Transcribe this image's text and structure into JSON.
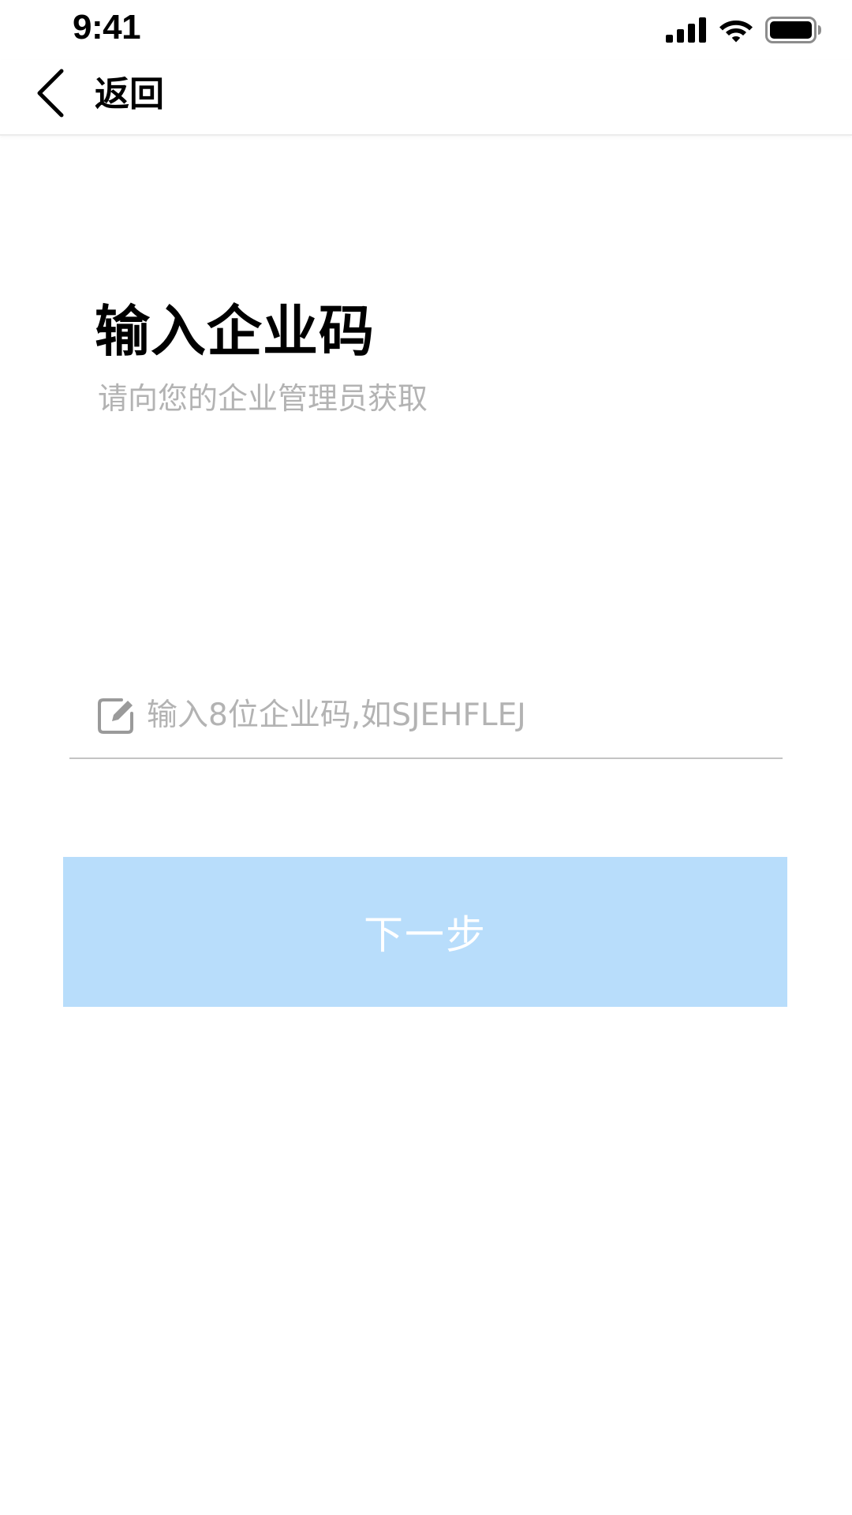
{
  "status_bar": {
    "time": "9:41",
    "icons": [
      "signal-icon",
      "wifi-icon",
      "battery-icon"
    ]
  },
  "nav": {
    "back_label": "返回",
    "back_icon": "chevron-left-icon"
  },
  "main": {
    "title": "输入企业码",
    "subtitle": "请向您的企业管理员获取",
    "code_input": {
      "placeholder": "输入8位企业码,如SJEHFLEJ",
      "value": "",
      "icon": "edit-icon"
    },
    "next_button_label": "下一步"
  },
  "colors": {
    "button_background": "#b8ddfb",
    "button_text": "#ffffff",
    "placeholder_text": "#b3b3b3",
    "subtitle_text": "#b3b3b3",
    "divider": "#c4c4c4"
  }
}
